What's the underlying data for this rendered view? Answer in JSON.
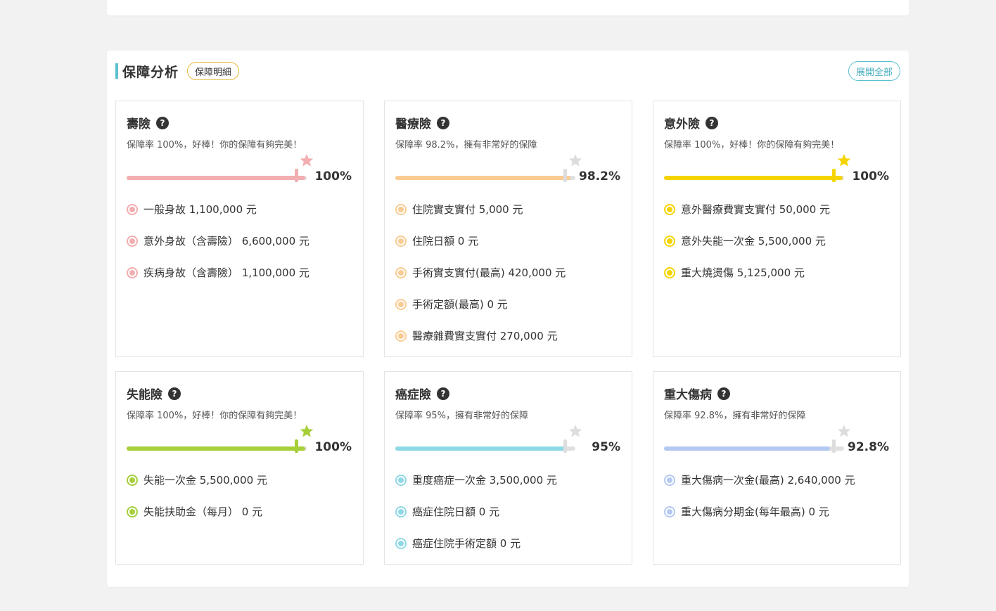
{
  "section": {
    "title": "保障分析",
    "detail_button": "保障明細",
    "expand_button": "展開全部"
  },
  "cards": [
    {
      "title": "壽險",
      "desc": "保障率 100%，好棒！你的保障有夠完美！",
      "percent_label": "100%",
      "rate": 1.0,
      "color": "#f2aeb0",
      "star_color": "#f2aeb0",
      "items": [
        "一般身故 1,100,000 元",
        "意外身故（含壽險） 6,600,000 元",
        "疾病身故（含壽險） 1,100,000 元"
      ]
    },
    {
      "title": "醫療險",
      "desc": "保障率 98.2%，擁有非常好的保障",
      "percent_label": "98.2%",
      "rate": 0.982,
      "color": "#fbcb92",
      "star_color": "#dddddd",
      "items": [
        "住院實支實付 5,000 元",
        "住院日額 0 元",
        "手術實支實付(最高) 420,000 元",
        "手術定額(最高) 0 元",
        "醫療雜費實支實付 270,000 元"
      ]
    },
    {
      "title": "意外險",
      "desc": "保障率 100%，好棒！你的保障有夠完美！",
      "percent_label": "100%",
      "rate": 1.0,
      "color": "#f6d400",
      "star_color": "#f6d400",
      "items": [
        "意外醫療費實支實付 50,000 元",
        "意外失能一次金 5,500,000 元",
        "重大燒燙傷 5,125,000 元"
      ]
    },
    {
      "title": "失能險",
      "desc": "保障率 100%，好棒！你的保障有夠完美！",
      "percent_label": "100%",
      "rate": 1.0,
      "color": "#a6cf3a",
      "star_color": "#a6cf3a",
      "items": [
        "失能一次金 5,500,000 元",
        "失能扶助金（每月） 0 元"
      ]
    },
    {
      "title": "癌症險",
      "desc": "保障率 95%，擁有非常好的保障",
      "percent_label": "95%",
      "rate": 0.95,
      "color": "#8fd8e6",
      "star_color": "#dddddd",
      "items": [
        "重度癌症一次金 3,500,000 元",
        "癌症住院日額 0 元",
        "癌症住院手術定額 0 元"
      ]
    },
    {
      "title": "重大傷病",
      "desc": "保障率 92.8%，擁有非常好的保障",
      "percent_label": "92.8%",
      "rate": 0.928,
      "color": "#b4c9f2",
      "star_color": "#dddddd",
      "items": [
        "重大傷病一次金(最高) 2,640,000 元",
        "重大傷病分期金(每年最高) 0 元"
      ]
    }
  ]
}
